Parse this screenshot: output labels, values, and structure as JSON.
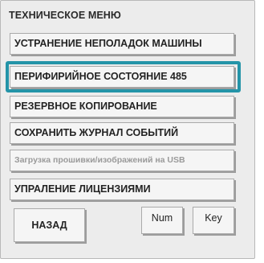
{
  "menu": {
    "title": "ТЕХНИЧЕСКОЕ МЕНЮ",
    "items": [
      {
        "label": "УСТРАНЕНИЕ НЕПОЛАДОК МАШИНЫ"
      },
      {
        "label": "ПЕРИФИРИЙНОЕ СОСТОЯНИЕ 485"
      },
      {
        "label": "РЕЗЕРВНОЕ КОПИРОВАНИЕ"
      },
      {
        "label": "СОХРАНИТЬ ЖУРНАЛ СОБЫТИЙ"
      },
      {
        "label": "Загрузка прошивки/изображений на USB"
      },
      {
        "label": "УПРАЛЕНИЕ ЛИЦЕНЗИЯМИ"
      }
    ],
    "selected_index": 1,
    "focus_color": "#2494a8"
  },
  "footer": {
    "back_label": "НАЗАД",
    "num_label": "Num",
    "key_label": "Key"
  }
}
